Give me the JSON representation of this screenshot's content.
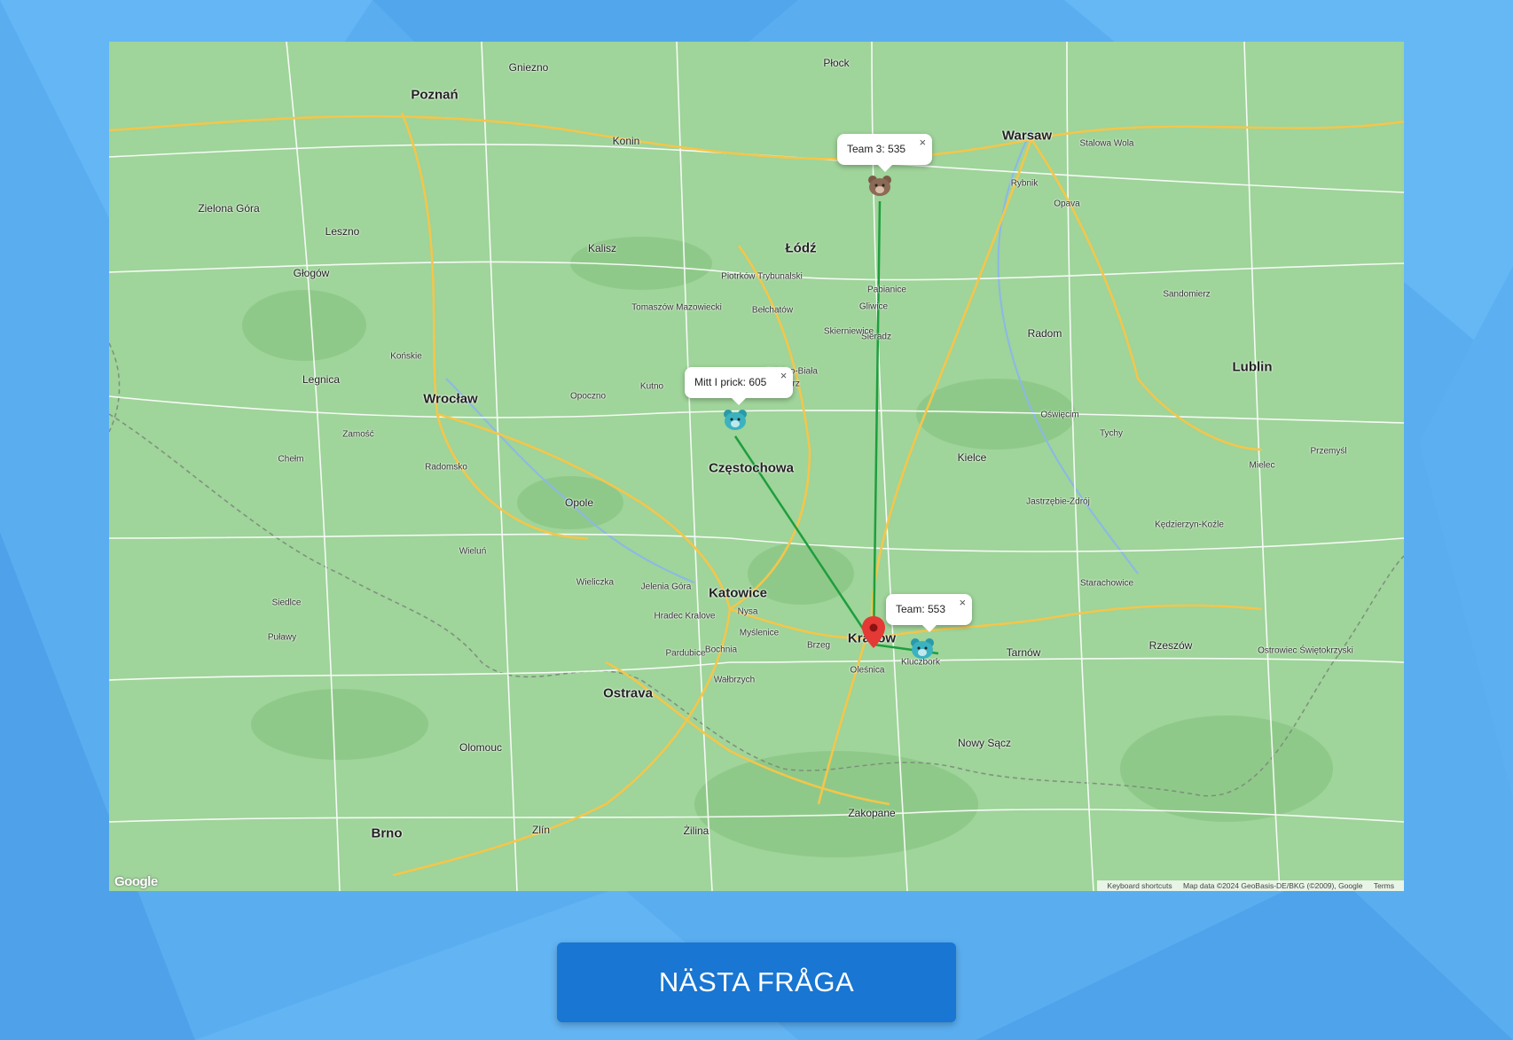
{
  "map": {
    "cities_big": [
      "Poznań",
      "Warsaw",
      "Łódź",
      "Wrocław",
      "Częstochowa",
      "Katowice",
      "Kraków",
      "Lublin",
      "Ostrava",
      "Brno"
    ],
    "cities_med": [
      "Płock",
      "Gniezno",
      "Konin",
      "Kalisz",
      "Opole",
      "Kielce",
      "Radom",
      "Rzeszów",
      "Tarnów",
      "Nowy Sącz",
      "Zakopane",
      "Żilina",
      "Olomouc",
      "Zlín",
      "Legnica",
      "Głogów",
      "Leszno",
      "Zielona Góra",
      "Piotrków Trybunalski",
      "Bełchatów",
      "Sieradz",
      "Pabianice",
      "Tomaszów Mazowiecki",
      "Skierniewice",
      "Bielsko-Biała",
      "Gliwice",
      "Rybnik",
      "Opava",
      "Wałbrzych",
      "Jelenia Góra",
      "Hradec Kralove",
      "Pardubice",
      "Zamość",
      "Chełm",
      "Siedlce",
      "Puławy",
      "Mielec",
      "Przemyśl",
      "Stalowa Wola",
      "Sandomierz",
      "Starachowice",
      "Ostrowiec Świętokrzyski",
      "Kędzierzyn-Koźle",
      "Jastrzębie-Zdrój",
      "Oświęcim",
      "Tychy",
      "Wieliczka",
      "Bochnia",
      "Myślenice",
      "Nysa",
      "Brzeg",
      "Oleśnica",
      "Kluczbork",
      "Wieluń",
      "Radomsko",
      "Końskie",
      "Opoczno",
      "Kutno",
      "Zgierz"
    ],
    "ui": {
      "bubbles": [
        {
          "name": "team-3",
          "text": "Team 3: 535"
        },
        {
          "name": "mitt-i-prick",
          "text": "Mitt I prick: 605"
        },
        {
          "name": "team",
          "text": "Team: 553"
        }
      ],
      "close_glyph": "×"
    },
    "google_logo": "Google",
    "attribution": {
      "shortcuts": "Keyboard shortcuts",
      "data": "Map data ©2024 GeoBasis-DE/BKG (©2009), Google",
      "terms": "Terms"
    }
  },
  "markers": {
    "team_3_icon": "bear-icon",
    "mitt_i_prick_icon": "bear-icon",
    "team_icon": "bear-icon",
    "answer_icon": "location-pin-icon",
    "line_color": "#1e9e3e"
  },
  "button": {
    "label": "NÄSTA FRÅGA",
    "color": "#1976d2"
  }
}
